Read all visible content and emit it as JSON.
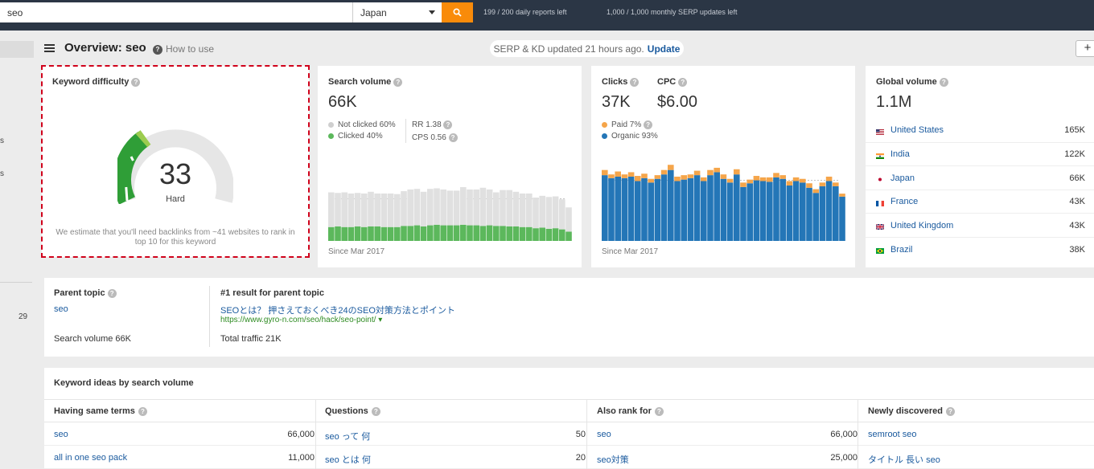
{
  "topbar": {
    "search_value": "seo",
    "country": "Japan",
    "daily_quota": "199 / 200 daily reports left",
    "monthly_quota": "1,000 / 1,000 monthly SERP updates left"
  },
  "sidebar": {
    "frag1": "s",
    "frag2": "s",
    "count": "29"
  },
  "header": {
    "title": "Overview: seo",
    "how_to_use": "How to use",
    "serp_status": "SERP & KD updated 21 hours ago.",
    "update_link": "Update",
    "plus": "+"
  },
  "keyword_difficulty": {
    "title": "Keyword difficulty",
    "value": 33,
    "value_text": "33",
    "label": "Hard",
    "description": "We estimate that you'll need backlinks from ~41 websites to rank in top 10 for this keyword"
  },
  "search_volume": {
    "title": "Search volume",
    "value": "66K",
    "not_clicked": "Not clicked 60%",
    "clicked": "Clicked 40%",
    "rr": "RR 1.38",
    "cps": "CPS 0.56",
    "since": "Since Mar 2017",
    "colors": {
      "not_clicked": "#e0e0e0",
      "clicked": "#5cb85c"
    }
  },
  "clicks": {
    "title": "Clicks",
    "value": "37K",
    "cpc_title": "CPC",
    "cpc_value": "$6.00",
    "paid": "Paid 7%",
    "organic": "Organic 93%",
    "since": "Since Mar 2017",
    "colors": {
      "paid": "#f5a54a",
      "organic": "#2476b7"
    }
  },
  "global_volume": {
    "title": "Global volume",
    "value": "1.1M",
    "countries": [
      {
        "name": "United States",
        "count": "165K",
        "flag": "us"
      },
      {
        "name": "India",
        "count": "122K",
        "flag": "in"
      },
      {
        "name": "Japan",
        "count": "66K",
        "flag": "jp"
      },
      {
        "name": "France",
        "count": "43K",
        "flag": "fr"
      },
      {
        "name": "United Kingdom",
        "count": "43K",
        "flag": "uk"
      },
      {
        "name": "Brazil",
        "count": "38K",
        "flag": "br"
      }
    ]
  },
  "parent_topic": {
    "title": "Parent topic",
    "topic": "seo",
    "search_volume": "Search volume 66K",
    "result_title": "#1 result for parent topic",
    "result_link": "SEOとは？ 押さえておくべき24のSEO対策方法とポイント",
    "result_url": "https://www.gyro-n.com/seo/hack/seo-point/",
    "total_traffic": "Total traffic 21K"
  },
  "keyword_ideas": {
    "title": "Keyword ideas by search volume",
    "columns": [
      {
        "title": "Having same terms",
        "items": [
          {
            "kw": "seo",
            "vol": "66,000"
          },
          {
            "kw": "all in one seo pack",
            "vol": "11,000"
          }
        ]
      },
      {
        "title": "Questions",
        "items": [
          {
            "kw": "seo って 何",
            "vol": "50"
          },
          {
            "kw": "seo とは 何",
            "vol": "20"
          }
        ]
      },
      {
        "title": "Also rank for",
        "items": [
          {
            "kw": "seo",
            "vol": "66,000"
          },
          {
            "kw": "seo対策",
            "vol": "25,000"
          }
        ]
      },
      {
        "title": "Newly discovered",
        "items": [
          {
            "kw": "semroot seo",
            "vol": ""
          },
          {
            "kw": "タイトル 長い seo",
            "vol": ""
          }
        ]
      }
    ]
  },
  "chart_data": [
    {
      "type": "bar",
      "title": "Search volume",
      "series": [
        {
          "name": "Not clicked",
          "values": [
            0.6,
            0.58,
            0.6,
            0.58,
            0.58,
            0.58,
            0.6,
            0.57,
            0.58,
            0.58,
            0.57,
            0.6,
            0.63,
            0.63,
            0.6,
            0.63,
            0.63,
            0.62,
            0.6,
            0.6,
            0.65,
            0.62,
            0.62,
            0.66,
            0.62,
            0.58,
            0.62,
            0.63,
            0.6,
            0.58,
            0.58,
            0.53,
            0.55,
            0.55,
            0.55,
            0.52,
            0.42
          ]
        },
        {
          "name": "Clicked",
          "values": [
            0.24,
            0.25,
            0.24,
            0.24,
            0.25,
            0.24,
            0.25,
            0.25,
            0.24,
            0.24,
            0.24,
            0.26,
            0.26,
            0.27,
            0.25,
            0.27,
            0.28,
            0.27,
            0.27,
            0.27,
            0.28,
            0.27,
            0.27,
            0.26,
            0.27,
            0.26,
            0.26,
            0.25,
            0.25,
            0.24,
            0.24,
            0.22,
            0.23,
            0.21,
            0.22,
            0.2,
            0.16
          ]
        }
      ]
    },
    {
      "type": "bar",
      "title": "Clicks",
      "series": [
        {
          "name": "Organic",
          "values": [
            0.89,
            0.85,
            0.87,
            0.85,
            0.87,
            0.81,
            0.85,
            0.79,
            0.84,
            0.9,
            0.96,
            0.81,
            0.83,
            0.85,
            0.89,
            0.81,
            0.89,
            0.93,
            0.84,
            0.79,
            0.9,
            0.73,
            0.78,
            0.82,
            0.81,
            0.8,
            0.86,
            0.84,
            0.75,
            0.81,
            0.79,
            0.72,
            0.65,
            0.74,
            0.81,
            0.74,
            0.6
          ]
        },
        {
          "name": "Paid",
          "values": [
            0.07,
            0.05,
            0.07,
            0.05,
            0.06,
            0.07,
            0.06,
            0.05,
            0.05,
            0.06,
            0.07,
            0.06,
            0.06,
            0.05,
            0.06,
            0.05,
            0.07,
            0.06,
            0.06,
            0.05,
            0.07,
            0.06,
            0.05,
            0.06,
            0.05,
            0.06,
            0.06,
            0.05,
            0.06,
            0.05,
            0.05,
            0.06,
            0.05,
            0.05,
            0.06,
            0.05,
            0.04
          ]
        }
      ]
    }
  ]
}
